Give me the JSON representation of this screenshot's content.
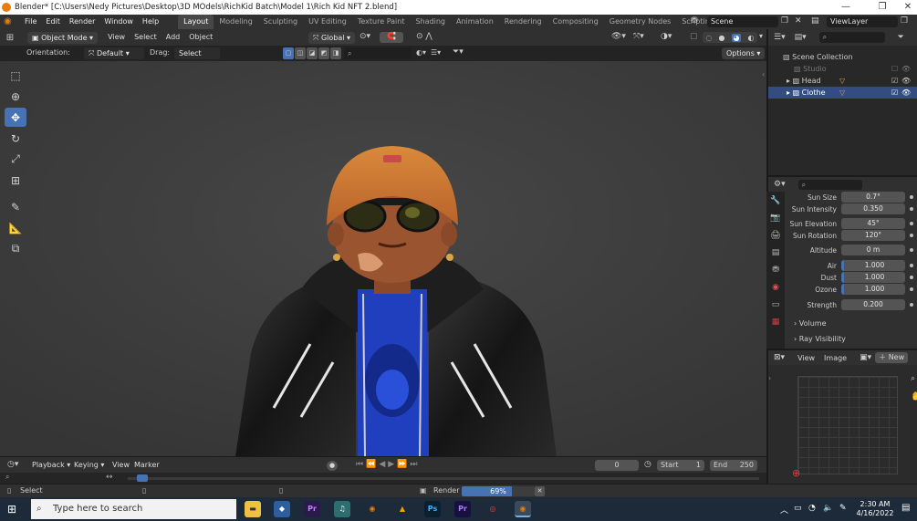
{
  "window": {
    "title": "Blender* [C:\\Users\\Nedy Pictures\\Desktop\\3D MOdels\\RichKid Batch\\Model 1\\Rich Kid NFT 2.blend]",
    "minimize": "—",
    "maximize": "❐",
    "close": "✕"
  },
  "menu": {
    "items": [
      "File",
      "Edit",
      "Render",
      "Window",
      "Help"
    ]
  },
  "workspaces": {
    "tabs": [
      "Layout",
      "Modeling",
      "Sculpting",
      "UV Editing",
      "Texture Paint",
      "Shading",
      "Animation",
      "Rendering",
      "Compositing",
      "Geometry Nodes",
      "Scripting"
    ],
    "add": "+"
  },
  "scene": {
    "label": "Scene",
    "viewlayer": "ViewLayer"
  },
  "viewport_header": {
    "mode": "Object Mode",
    "menus": [
      "View",
      "Select",
      "Add",
      "Object"
    ],
    "transform": "Global"
  },
  "tool_header": {
    "orientation_label": "Orientation:",
    "orientation_value": "Default",
    "drag_label": "Drag:",
    "drag_value": "Select Box",
    "options": "Options"
  },
  "outliner": {
    "root": "Scene Collection",
    "items": [
      {
        "name": "Studio"
      },
      {
        "name": "Head"
      },
      {
        "name": "Clothe"
      }
    ]
  },
  "properties": {
    "rows": [
      {
        "label": "Sun Size",
        "value": "0.7°"
      },
      {
        "label": "Sun Intensity",
        "value": "0.350"
      },
      {
        "label": "Sun Elevation",
        "value": "45°"
      },
      {
        "label": "Sun Rotation",
        "value": "120°"
      },
      {
        "label": "Altitude",
        "value": "0 m"
      },
      {
        "label": "Air",
        "value": "1.000"
      },
      {
        "label": "Dust",
        "value": "1.000"
      },
      {
        "label": "Ozone",
        "value": "1.000"
      },
      {
        "label": "Strength",
        "value": "0.200"
      }
    ],
    "panels": [
      "Volume",
      "Ray Visibility"
    ]
  },
  "image_editor": {
    "menus": [
      "View",
      "Image"
    ],
    "new_button": "New"
  },
  "timeline": {
    "menus": [
      "Playback",
      "Keying",
      "View",
      "Marker"
    ],
    "current_frame": "0",
    "start_label": "Start",
    "start_value": "1",
    "end_label": "End",
    "end_value": "250"
  },
  "statusbar": {
    "select": "Select",
    "render_label": "Render",
    "render_progress": "69%",
    "render_fraction": 0.69
  },
  "taskbar": {
    "search_placeholder": "Type here to search",
    "time": "2:30 AM",
    "date": "4/16/2022"
  },
  "colors": {
    "accent": "#4772b3",
    "selected_row": "#334d80",
    "viewport_bg": "#3b3b3b",
    "orange": "#e87d0d"
  }
}
